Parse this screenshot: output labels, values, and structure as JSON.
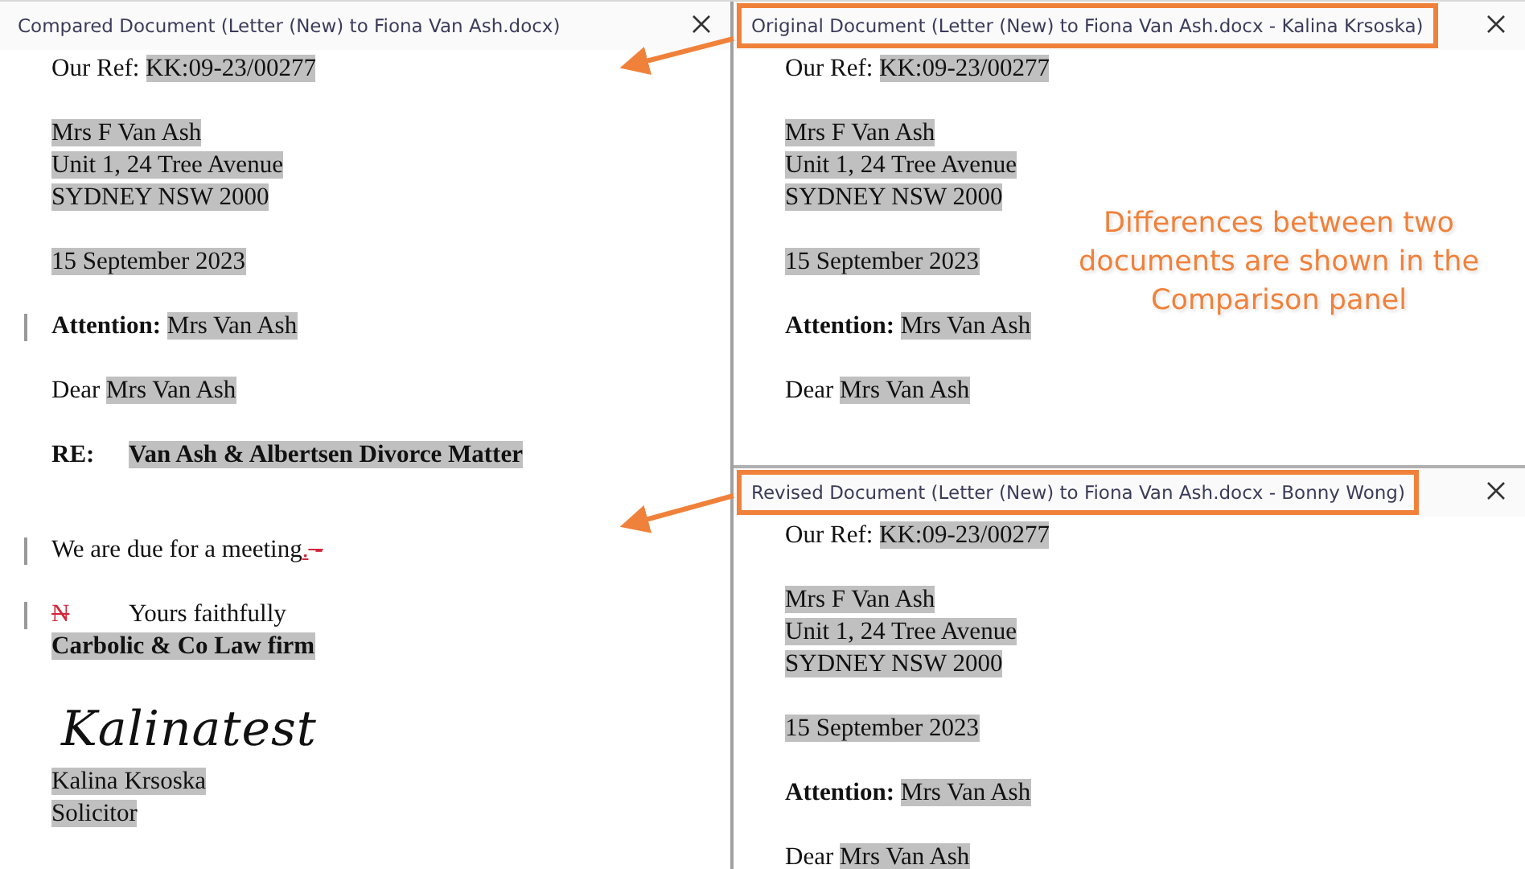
{
  "panes": [
    {
      "title": "Compared Document (Letter (New) to Fiona Van Ash.docx)",
      "highlighted": false,
      "paragraphs": [
        {
          "kind": "normal",
          "change_bar": false,
          "lines": [
            [
              {
                "kind": "plain",
                "text": "Our Ref: ",
                "bold": false,
                "shaded": false
              },
              {
                "kind": "plain",
                "text": "KK:09-23/00277",
                "bold": false,
                "shaded": true
              }
            ]
          ]
        },
        {
          "kind": "normal",
          "change_bar": false,
          "lines": [
            [
              {
                "kind": "plain",
                "text": "Mrs F Van Ash",
                "bold": false,
                "shaded": true
              }
            ],
            [
              {
                "kind": "plain",
                "text": "Unit 1, 24 Tree Avenue",
                "bold": false,
                "shaded": true
              }
            ],
            [
              {
                "kind": "plain",
                "text": "SYDNEY NSW 2000",
                "bold": false,
                "shaded": true
              }
            ]
          ]
        },
        {
          "kind": "normal",
          "change_bar": false,
          "lines": [
            [
              {
                "kind": "plain",
                "text": "15 September 2023",
                "bold": false,
                "shaded": true
              }
            ]
          ]
        },
        {
          "kind": "normal",
          "change_bar": true,
          "lines": [
            [
              {
                "kind": "plain",
                "text": "Attention: ",
                "bold": true,
                "shaded": false
              },
              {
                "kind": "plain",
                "text": "Mrs Van Ash",
                "bold": false,
                "shaded": true
              }
            ]
          ]
        },
        {
          "kind": "normal",
          "change_bar": false,
          "lines": [
            [
              {
                "kind": "plain",
                "text": "Dear ",
                "bold": false,
                "shaded": false
              },
              {
                "kind": "plain",
                "text": "Mrs Van Ash",
                "bold": false,
                "shaded": true
              }
            ]
          ]
        },
        {
          "kind": "subject",
          "change_bar": false,
          "lines": [
            [
              {
                "kind": "tab",
                "text": "RE:",
                "bold": true,
                "shaded": false
              },
              {
                "kind": "plain",
                "text": "Van Ash & Albertsen Divorce Matter",
                "bold": true,
                "shaded": true
              }
            ]
          ]
        },
        {
          "kind": "normal",
          "change_bar": true,
          "lines": [
            [
              {
                "kind": "plain",
                "text": "We are due for a meeting",
                "bold": false,
                "shaded": false
              },
              {
                "kind": "inserted",
                "text": ".",
                "bold": false,
                "shaded": false
              },
              {
                "kind": "deleted",
                "text": " -",
                "bold": false,
                "shaded": false
              }
            ]
          ]
        },
        {
          "kind": "closing",
          "change_bar": true,
          "lines": [
            [
              {
                "kind": "deleted_tab",
                "text": "N",
                "bold": false,
                "shaded": false
              },
              {
                "kind": "plain",
                "text": "Yours faithfully",
                "bold": false,
                "shaded": false
              }
            ],
            [
              {
                "kind": "plain",
                "text": "Carbolic & Co Law firm",
                "bold": true,
                "shaded": true
              }
            ]
          ]
        },
        {
          "kind": "signature",
          "change_bar": false,
          "text": "Kalinatest"
        },
        {
          "kind": "normal",
          "change_bar": false,
          "lines": [
            [
              {
                "kind": "plain",
                "text": "Kalina Krsoska",
                "bold": false,
                "shaded": true
              }
            ],
            [
              {
                "kind": "plain",
                "text": "Solicitor",
                "bold": false,
                "shaded": true
              }
            ]
          ]
        }
      ]
    },
    {
      "title": "Original Document (Letter (New) to Fiona Van Ash.docx - Kalina Krsoska)",
      "highlighted": true,
      "paragraphs": [
        {
          "kind": "normal",
          "change_bar": false,
          "lines": [
            [
              {
                "kind": "plain",
                "text": "Our Ref: ",
                "bold": false,
                "shaded": false
              },
              {
                "kind": "plain",
                "text": "KK:09-23/00277",
                "bold": false,
                "shaded": true
              }
            ]
          ]
        },
        {
          "kind": "normal",
          "change_bar": false,
          "lines": [
            [
              {
                "kind": "plain",
                "text": "Mrs F Van Ash",
                "bold": false,
                "shaded": true
              }
            ],
            [
              {
                "kind": "plain",
                "text": "Unit 1, 24 Tree Avenue",
                "bold": false,
                "shaded": true
              }
            ],
            [
              {
                "kind": "plain",
                "text": "SYDNEY NSW 2000",
                "bold": false,
                "shaded": true
              }
            ]
          ]
        },
        {
          "kind": "normal",
          "change_bar": false,
          "lines": [
            [
              {
                "kind": "plain",
                "text": "15 September 2023",
                "bold": false,
                "shaded": true
              }
            ]
          ]
        },
        {
          "kind": "normal",
          "change_bar": false,
          "lines": [
            [
              {
                "kind": "plain",
                "text": "Attention: ",
                "bold": true,
                "shaded": false
              },
              {
                "kind": "plain",
                "text": "Mrs Van Ash",
                "bold": false,
                "shaded": true
              }
            ]
          ]
        },
        {
          "kind": "normal",
          "change_bar": false,
          "lines": [
            [
              {
                "kind": "plain",
                "text": "Dear ",
                "bold": false,
                "shaded": false
              },
              {
                "kind": "plain",
                "text": "Mrs Van Ash",
                "bold": false,
                "shaded": true
              }
            ]
          ]
        }
      ]
    },
    {
      "title": "Revised Document (Letter (New) to Fiona Van Ash.docx - Bonny Wong)",
      "highlighted": true,
      "paragraphs": [
        {
          "kind": "normal",
          "change_bar": false,
          "lines": [
            [
              {
                "kind": "plain",
                "text": "Our Ref: ",
                "bold": false,
                "shaded": false
              },
              {
                "kind": "plain",
                "text": "KK:09-23/00277",
                "bold": false,
                "shaded": true
              }
            ]
          ]
        },
        {
          "kind": "normal",
          "change_bar": false,
          "lines": [
            [
              {
                "kind": "plain",
                "text": "Mrs F Van Ash",
                "bold": false,
                "shaded": true
              }
            ],
            [
              {
                "kind": "plain",
                "text": "Unit 1, 24 Tree Avenue",
                "bold": false,
                "shaded": true
              }
            ],
            [
              {
                "kind": "plain",
                "text": "SYDNEY NSW 2000",
                "bold": false,
                "shaded": true
              }
            ]
          ]
        },
        {
          "kind": "normal",
          "change_bar": false,
          "lines": [
            [
              {
                "kind": "plain",
                "text": "15 September 2023",
                "bold": false,
                "shaded": true
              }
            ]
          ]
        },
        {
          "kind": "normal",
          "change_bar": false,
          "lines": [
            [
              {
                "kind": "plain",
                "text": "Attention: ",
                "bold": true,
                "shaded": false
              },
              {
                "kind": "plain",
                "text": "Mrs Van Ash",
                "bold": false,
                "shaded": true
              }
            ]
          ]
        },
        {
          "kind": "normal",
          "change_bar": false,
          "lines": [
            [
              {
                "kind": "plain",
                "text": "Dear ",
                "bold": false,
                "shaded": false
              },
              {
                "kind": "plain",
                "text": "Mrs Van Ash",
                "bold": false,
                "shaded": true
              }
            ]
          ]
        }
      ]
    }
  ],
  "callout": "Differences between two documents are shown in the Comparison panel"
}
